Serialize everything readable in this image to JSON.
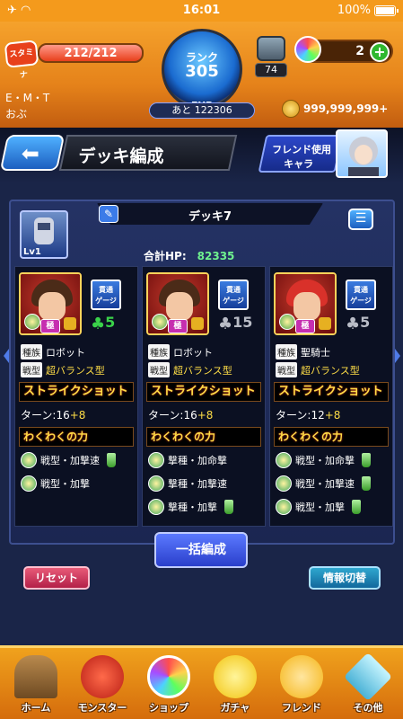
{
  "status_bar": {
    "time": "16:01",
    "battery": "100%"
  },
  "header": {
    "stamina_label": "スタミナ",
    "stamina": "212/212",
    "stamina_fraction": 1.0,
    "rank_label": "ランク",
    "rank": "305",
    "exp_label": "EXP",
    "exp_remaining": "あと 122306",
    "item_count": "74",
    "orb_count": "2",
    "player_line1": "E・M・T",
    "player_line2": "おぶ",
    "gold": "999,999,999+"
  },
  "title_row": {
    "title": "デッキ編成",
    "friend_button_line1": "フレンド使用",
    "friend_button_line2": "キャラ"
  },
  "deck": {
    "name": "デッキ7",
    "leader_level": "Lv1",
    "total_hp_label": "合計HP:",
    "total_hp": "82335",
    "monsters": [
      {
        "ability_line1": "貫通",
        "ability_line2": "ゲージ",
        "luck": "5",
        "luck_color": "green",
        "race_label": "種族",
        "race": "ロボット",
        "battle_label": "戦型",
        "battle_type": "超バランス型",
        "strike_shot": "ストライクショット",
        "turns": "ターン:16",
        "turns_plus": "+8",
        "waku_title": "わくわくの力",
        "waku": [
          "戦型・加撃速",
          "戦型・加撃"
        ]
      },
      {
        "ability_line1": "貫通",
        "ability_line2": "ゲージ",
        "luck": "15",
        "luck_color": "gray",
        "race_label": "種族",
        "race": "ロボット",
        "battle_label": "戦型",
        "battle_type": "超バランス型",
        "strike_shot": "ストライクショット",
        "turns": "ターン:16",
        "turns_plus": "+8",
        "waku_title": "わくわくの力",
        "waku": [
          "撃種・加命撃",
          "撃種・加撃速",
          "撃種・加撃"
        ]
      },
      {
        "ability_line1": "貫通",
        "ability_line2": "ゲージ",
        "luck": "5",
        "luck_color": "gray",
        "race_label": "種族",
        "race": "聖騎士",
        "battle_label": "戦型",
        "battle_type": "超バランス型",
        "strike_shot": "ストライクショット",
        "turns": "ターン:12",
        "turns_plus": "+8",
        "waku_title": "わくわくの力",
        "waku": [
          "戦型・加命撃",
          "戦型・加撃速",
          "戦型・加撃"
        ]
      }
    ],
    "kyoku_badge": "極"
  },
  "actions": {
    "ikkatsu": "一括編成",
    "reset": "リセット",
    "info_switch": "情報切替"
  },
  "nav": {
    "home": "ホーム",
    "monster": "モンスター",
    "shop": "ショップ",
    "gacha": "ガチャ",
    "friend": "フレンド",
    "other": "その他"
  },
  "colors": {
    "header_orange": "#f49a1c",
    "panel_blue": "#243264",
    "strike_yellow": "#ffde47",
    "hp_green": "#6ff28f"
  }
}
